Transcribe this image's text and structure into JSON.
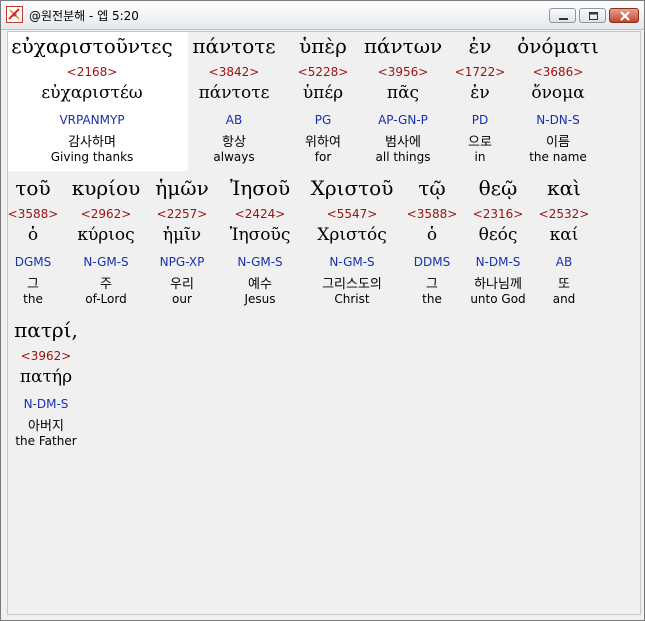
{
  "window": {
    "title": "@원전분해 - 엡 5:20",
    "icon": "app-icon"
  },
  "words": [
    {
      "greek": "εὐχαριστοῦντες",
      "strong": "<2168>",
      "lemma": "εὐχαριστέω",
      "parse": "VRPANMYP",
      "korean": "감사하며",
      "english": "Giving thanks"
    },
    {
      "greek": "πάντοτε",
      "strong": "<3842>",
      "lemma": "πάντοτε",
      "parse": "AB",
      "korean": "항상",
      "english": "always"
    },
    {
      "greek": "ὑπὲρ",
      "strong": "<5228>",
      "lemma": "ὑπέρ",
      "parse": "PG",
      "korean": "위하여",
      "english": "for"
    },
    {
      "greek": "πάντων",
      "strong": "<3956>",
      "lemma": "πᾶς",
      "parse": "AP-GN-P",
      "korean": "범사에",
      "english": "all things"
    },
    {
      "greek": "ἐν",
      "strong": "<1722>",
      "lemma": "ἐν",
      "parse": "PD",
      "korean": "으로",
      "english": "in"
    },
    {
      "greek": "ὀνόματι",
      "strong": "<3686>",
      "lemma": "ὄνομα",
      "parse": "N-DN-S",
      "korean": "이름",
      "english": "the name"
    },
    {
      "greek": "τοῦ",
      "strong": "<3588>",
      "lemma": "ὁ",
      "parse": "DGMS",
      "korean": "그",
      "english": "the"
    },
    {
      "greek": "κυρίου",
      "strong": "<2962>",
      "lemma": "κύριος",
      "parse": "N-GM-S",
      "korean": "주",
      "english": "of-Lord"
    },
    {
      "greek": "ἡμῶν",
      "strong": "<2257>",
      "lemma": "ἡμῖν",
      "parse": "NPG-XP",
      "korean": "우리",
      "english": "our"
    },
    {
      "greek": "Ἰησοῦ",
      "strong": "<2424>",
      "lemma": "Ἰησοῦς",
      "parse": "N-GM-S",
      "korean": "예수",
      "english": "Jesus"
    },
    {
      "greek": "Χριστοῦ",
      "strong": "<5547>",
      "lemma": "Χριστός",
      "parse": "N-GM-S",
      "korean": "그리스도의",
      "english": "Christ"
    },
    {
      "greek": "τῷ",
      "strong": "<3588>",
      "lemma": "ὁ",
      "parse": "DDMS",
      "korean": "그",
      "english": "the"
    },
    {
      "greek": "θεῷ",
      "strong": "<2316>",
      "lemma": "θεός",
      "parse": "N-DM-S",
      "korean": "하나님께",
      "english": "unto God"
    },
    {
      "greek": "καὶ",
      "strong": "<2532>",
      "lemma": "καί",
      "parse": "AB",
      "korean": "또",
      "english": "and"
    },
    {
      "greek": "πατρί,",
      "strong": "<3962>",
      "lemma": "πατήρ",
      "parse": "N-DM-S",
      "korean": "아버지",
      "english": "the Father"
    }
  ]
}
